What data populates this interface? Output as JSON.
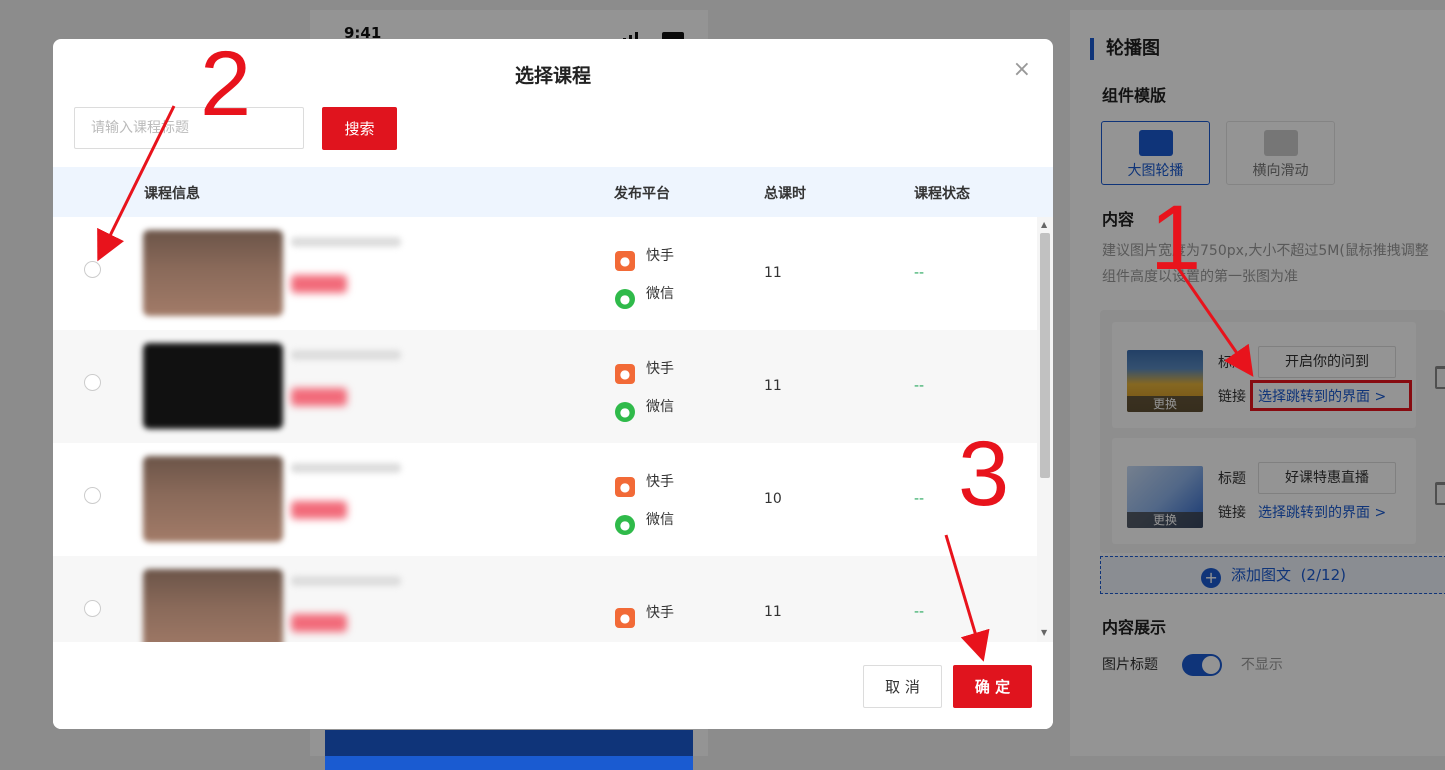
{
  "phone": {
    "time": "9:41"
  },
  "right_panel": {
    "title": "轮播图",
    "template_heading": "组件模版",
    "templates": [
      {
        "label": "大图轮播",
        "active": true
      },
      {
        "label": "横向滑动",
        "active": false
      }
    ],
    "content_heading": "内容",
    "hint_line1": "建议图片宽度为750px,大小不超过5M(鼠标推拽调整",
    "hint_line2": "组件高度以设置的第一张图为准",
    "items": [
      {
        "title_label": "标题",
        "title_value": "开启你的问到",
        "link_label": "链接",
        "link_text": "选择跳转到的界面 >",
        "swap_label": "更换"
      },
      {
        "title_label": "标题",
        "title_value": "好课特惠直播",
        "link_label": "链接",
        "link_text": "选择跳转到的界面 >",
        "swap_label": "更换"
      }
    ],
    "add_label": "添加图文",
    "add_count": "(2/12)",
    "display_heading": "内容展示",
    "image_title_label": "图片标题",
    "image_title_state": "不显示"
  },
  "modal": {
    "title": "选择课程",
    "close_glyph": "×",
    "search_placeholder": "请输入课程标题",
    "search_button": "搜索",
    "columns": {
      "info": "课程信息",
      "platform": "发布平台",
      "hours": "总课时",
      "status": "课程状态"
    },
    "rows": [
      {
        "platforms": [
          "快手",
          "微信"
        ],
        "hours": "11",
        "status": "--"
      },
      {
        "platforms": [
          "快手",
          "微信"
        ],
        "hours": "11",
        "status": "--"
      },
      {
        "platforms": [
          "快手",
          "微信"
        ],
        "hours": "10",
        "status": "--"
      },
      {
        "platforms": [
          "快手"
        ],
        "hours": "11",
        "status": "--"
      }
    ],
    "cancel_button": "取 消",
    "ok_button": "确 定"
  },
  "annotations": {
    "n1": "1",
    "n2": "2",
    "n3": "3"
  },
  "colors": {
    "accent": "#1a5bd1",
    "danger": "#e0141e",
    "annotation": "#e8131c",
    "status_green": "#2aa85f"
  }
}
